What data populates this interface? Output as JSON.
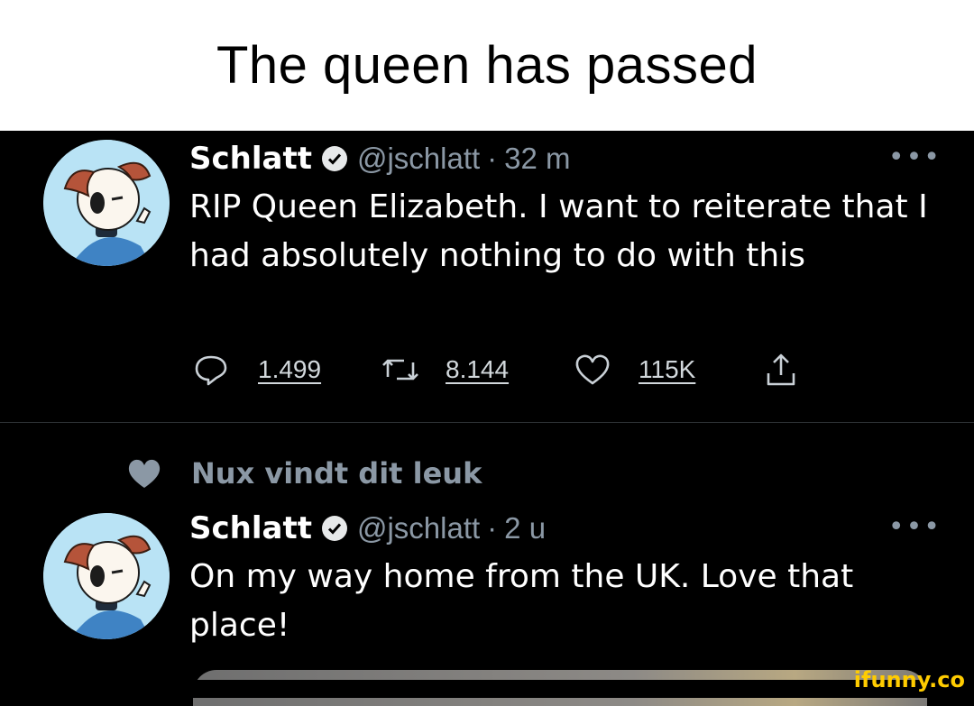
{
  "caption": "The queen has passed",
  "tweets": [
    {
      "display_name": "Schlatt",
      "handle": "@jschlatt",
      "separator": "·",
      "time": "32 m",
      "text": "RIP Queen Elizabeth. I want to reiterate that I had absolutely nothing to do with this",
      "more": "•••",
      "actions": {
        "replies": "1.499",
        "retweets": "8.144",
        "likes": "115K"
      }
    },
    {
      "display_name": "Schlatt",
      "handle": "@jschlatt",
      "separator": "·",
      "time": "2 u",
      "text": "On my way home from the UK. Love that place!",
      "more": "•••"
    }
  ],
  "social_context": {
    "label": "Nux vindt dit leuk"
  },
  "watermark": "ifunny.co",
  "colors": {
    "background": "#000000",
    "text": "#ffffff",
    "secondary": "#8b98a5",
    "avatar_bg": "#b9e3f5",
    "watermark": "#ffcc00"
  },
  "icons": [
    "verified-badge-icon",
    "reply-icon",
    "retweet-icon",
    "like-icon",
    "share-icon",
    "heart-icon",
    "more-icon"
  ]
}
